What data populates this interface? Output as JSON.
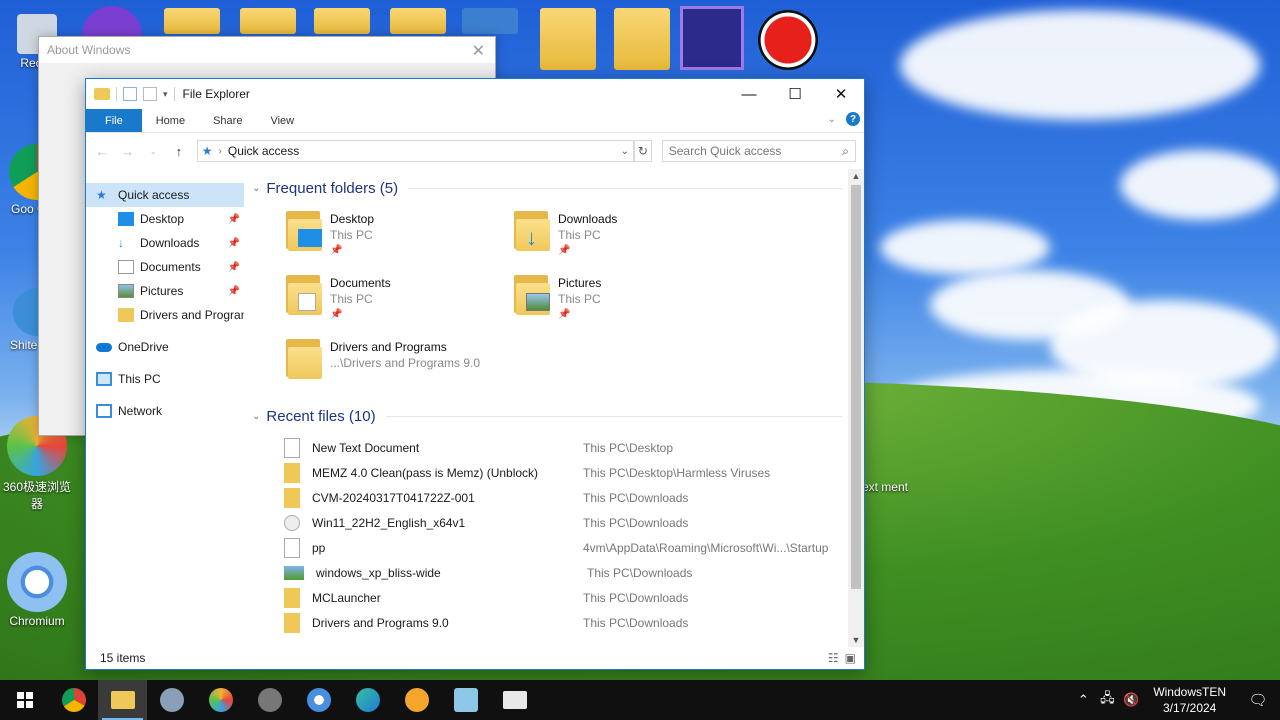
{
  "desktop": {
    "icons": [
      {
        "label": "Recyc"
      },
      {
        "label": "Goo Chro"
      },
      {
        "label": "Shite Expl"
      },
      {
        "label": "360极速浏览器"
      },
      {
        "label": "Chromium"
      },
      {
        "label": "Text ment"
      }
    ]
  },
  "about": {
    "title": "About Windows"
  },
  "explorer": {
    "title": "File Explorer",
    "tabs": [
      "File",
      "Home",
      "Share",
      "View"
    ],
    "address": "Quick access",
    "search_placeholder": "Search Quick access",
    "nav": {
      "quick_access": "Quick access",
      "pinned": [
        {
          "label": "Desktop",
          "icon": "desktop-icon"
        },
        {
          "label": "Downloads",
          "icon": "downloads-icon"
        },
        {
          "label": "Documents",
          "icon": "documents-icon"
        },
        {
          "label": "Pictures",
          "icon": "pictures-icon"
        },
        {
          "label": "Drivers and Programs",
          "icon": "folder-icon"
        }
      ],
      "onedrive": "OneDrive",
      "this_pc": "This PC",
      "network": "Network"
    },
    "frequent": {
      "header": "Frequent folders (5)",
      "items": [
        {
          "name": "Desktop",
          "sub": "This PC"
        },
        {
          "name": "Downloads",
          "sub": "This PC"
        },
        {
          "name": "Documents",
          "sub": "This PC"
        },
        {
          "name": "Pictures",
          "sub": "This PC"
        },
        {
          "name": "Drivers and Programs",
          "sub": "...\\Drivers and Programs 9.0"
        }
      ]
    },
    "recent": {
      "header": "Recent files (10)",
      "items": [
        {
          "name": "New Text Document",
          "path": "This PC\\Desktop"
        },
        {
          "name": "MEMZ 4.0 Clean(pass is Memz) (Unblock)",
          "path": "This PC\\Desktop\\Harmless Viruses"
        },
        {
          "name": "CVM-20240317T041722Z-001",
          "path": "This PC\\Downloads"
        },
        {
          "name": "Win11_22H2_English_x64v1",
          "path": "This PC\\Downloads"
        },
        {
          "name": "pp",
          "path": "4vm\\AppData\\Roaming\\Microsoft\\Wi...\\Startup"
        },
        {
          "name": "windows_xp_bliss-wide",
          "path": "This PC\\Downloads"
        },
        {
          "name": "MCLauncher",
          "path": "This PC\\Downloads"
        },
        {
          "name": "Drivers and Programs 9.0",
          "path": "This PC\\Downloads"
        }
      ]
    },
    "status": "15 items"
  },
  "taskbar": {
    "user": "WindowsTEN",
    "date": "3/17/2024"
  },
  "colors": {
    "accent": "#1979ca",
    "selection": "#cce4f7",
    "section_header": "#1e3287"
  }
}
